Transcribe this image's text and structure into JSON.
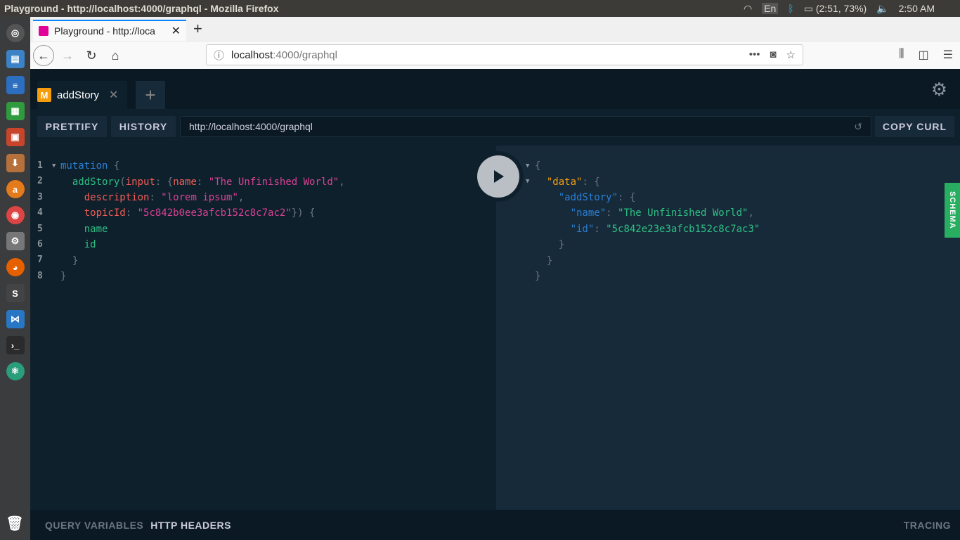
{
  "os": {
    "window_title": "Playground - http://localhost:4000/graphql - Mozilla Firefox",
    "lang": "En",
    "battery": "(2:51, 73%)",
    "time": "2:50 AM"
  },
  "browser": {
    "tab_title": "Playground - http://loca",
    "url_host": "localhost",
    "url_rest": ":4000/graphql"
  },
  "playground": {
    "tab_label": "addStory",
    "tab_icon": "M",
    "prettify": "PRETTIFY",
    "history": "HISTORY",
    "endpoint": "http://localhost:4000/graphql",
    "copy_curl": "COPY CURL",
    "schema": "SCHEMA",
    "query_variables": "QUERY VARIABLES",
    "http_headers": "HTTP HEADERS",
    "tracing": "TRACING",
    "query_lines": [
      [
        [
          "t-kw",
          "mutation"
        ],
        [
          "t-p",
          " {"
        ]
      ],
      [
        [
          "t-p",
          "  "
        ],
        [
          "t-fn",
          "addStory"
        ],
        [
          "t-p",
          "("
        ],
        [
          "t-arg",
          "input"
        ],
        [
          "t-p",
          ": {"
        ],
        [
          "t-arg",
          "name"
        ],
        [
          "t-p",
          ": "
        ],
        [
          "t-str",
          "\"The Unfinished World\""
        ],
        [
          "t-p",
          ","
        ]
      ],
      [
        [
          "t-p",
          "    "
        ],
        [
          "t-arg",
          "description"
        ],
        [
          "t-p",
          ": "
        ],
        [
          "t-str",
          "\"lorem ipsum\""
        ],
        [
          "t-p",
          ","
        ]
      ],
      [
        [
          "t-p",
          "    "
        ],
        [
          "t-arg",
          "topicId"
        ],
        [
          "t-p",
          ": "
        ],
        [
          "t-str",
          "\"5c842b0ee3afcb152c8c7ac2\""
        ],
        [
          "t-p",
          "}) {"
        ]
      ],
      [
        [
          "t-p",
          "    "
        ],
        [
          "t-fld",
          "name"
        ]
      ],
      [
        [
          "t-p",
          "    "
        ],
        [
          "t-fld",
          "id"
        ]
      ],
      [
        [
          "t-p",
          "  }"
        ]
      ],
      [
        [
          "t-p",
          "}"
        ]
      ]
    ],
    "result_lines": [
      [
        [
          "j-p",
          "{"
        ]
      ],
      [
        [
          "j-p",
          "  "
        ],
        [
          "j-data",
          "\"data\""
        ],
        [
          "j-p",
          ": {"
        ]
      ],
      [
        [
          "j-p",
          "    "
        ],
        [
          "j-key",
          "\"addStory\""
        ],
        [
          "j-p",
          ": {"
        ]
      ],
      [
        [
          "j-p",
          "      "
        ],
        [
          "j-key",
          "\"name\""
        ],
        [
          "j-p",
          ": "
        ],
        [
          "j-str",
          "\"The Unfinished World\""
        ],
        [
          "j-p",
          ","
        ]
      ],
      [
        [
          "j-p",
          "      "
        ],
        [
          "j-key",
          "\"id\""
        ],
        [
          "j-p",
          ": "
        ],
        [
          "j-str",
          "\"5c842e23e3afcb152c8c7ac3\""
        ]
      ],
      [
        [
          "j-p",
          "    }"
        ]
      ],
      [
        [
          "j-p",
          "  }"
        ]
      ],
      [
        [
          "j-p",
          "}"
        ]
      ]
    ]
  }
}
